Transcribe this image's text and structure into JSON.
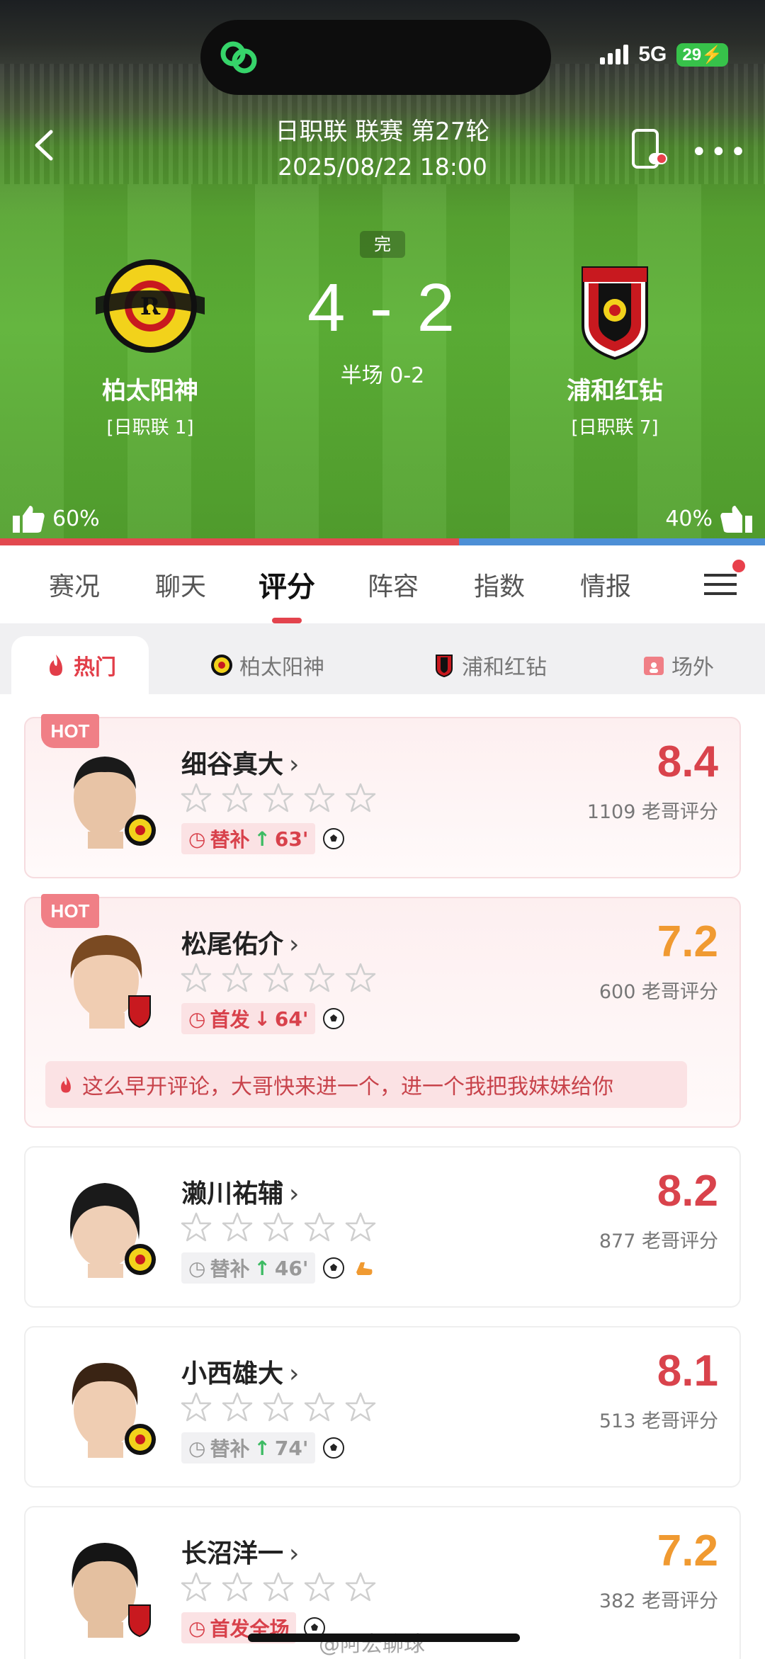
{
  "status_bar": {
    "network": "5G",
    "battery": "29"
  },
  "header": {
    "title": "日职联 联赛 第27轮",
    "datetime": "2025/08/22 18:00",
    "status": "完",
    "score": "4 - 2",
    "halftime": "半场 0-2",
    "home": {
      "name": "柏太阳神",
      "rank": "[日职联 1]",
      "vote": "60%",
      "color": "#e2494f"
    },
    "away": {
      "name": "浦和红钻",
      "rank": "[日职联 7]",
      "vote": "40%",
      "color": "#4d8fd6"
    },
    "vote_share": {
      "home": 0.6,
      "away": 0.4
    }
  },
  "tabs": [
    "赛况",
    "聊天",
    "评分",
    "阵容",
    "指数",
    "情报"
  ],
  "active_tab": "评分",
  "subtabs": {
    "hot": "热门",
    "home": "柏太阳神",
    "away": "浦和红钻",
    "other": "场外"
  },
  "players": [
    {
      "name": "细谷真大",
      "hot": "HOT",
      "role": "替补",
      "minute": "63'",
      "direction": "in",
      "rating": "8.4",
      "votes": "1109 老哥评分",
      "team": "home"
    },
    {
      "name": "松尾佑介",
      "hot": "HOT",
      "role": "首发",
      "minute": "64'",
      "direction": "out",
      "rating": "7.2",
      "votes": "600 老哥评分",
      "team": "away",
      "comment": "这么早开评论，大哥快来进一个，进一个我把我妹妹给你"
    },
    {
      "name": "濑川祐辅",
      "role": "替补",
      "minute": "46'",
      "direction": "in",
      "rating": "8.2",
      "votes": "877 老哥评分",
      "team": "home"
    },
    {
      "name": "小西雄大",
      "role": "替补",
      "minute": "74'",
      "direction": "in",
      "rating": "8.1",
      "votes": "513 老哥评分",
      "team": "home"
    },
    {
      "name": "长沼洋一",
      "role": "首发全场",
      "rating": "7.2",
      "votes": "382 老哥评分",
      "team": "away"
    }
  ],
  "colors": {
    "accent": "#e3434d",
    "rating_high": "#d9434c",
    "rating_mid": "#f09a31"
  },
  "watermark": "@阿宏聊球"
}
